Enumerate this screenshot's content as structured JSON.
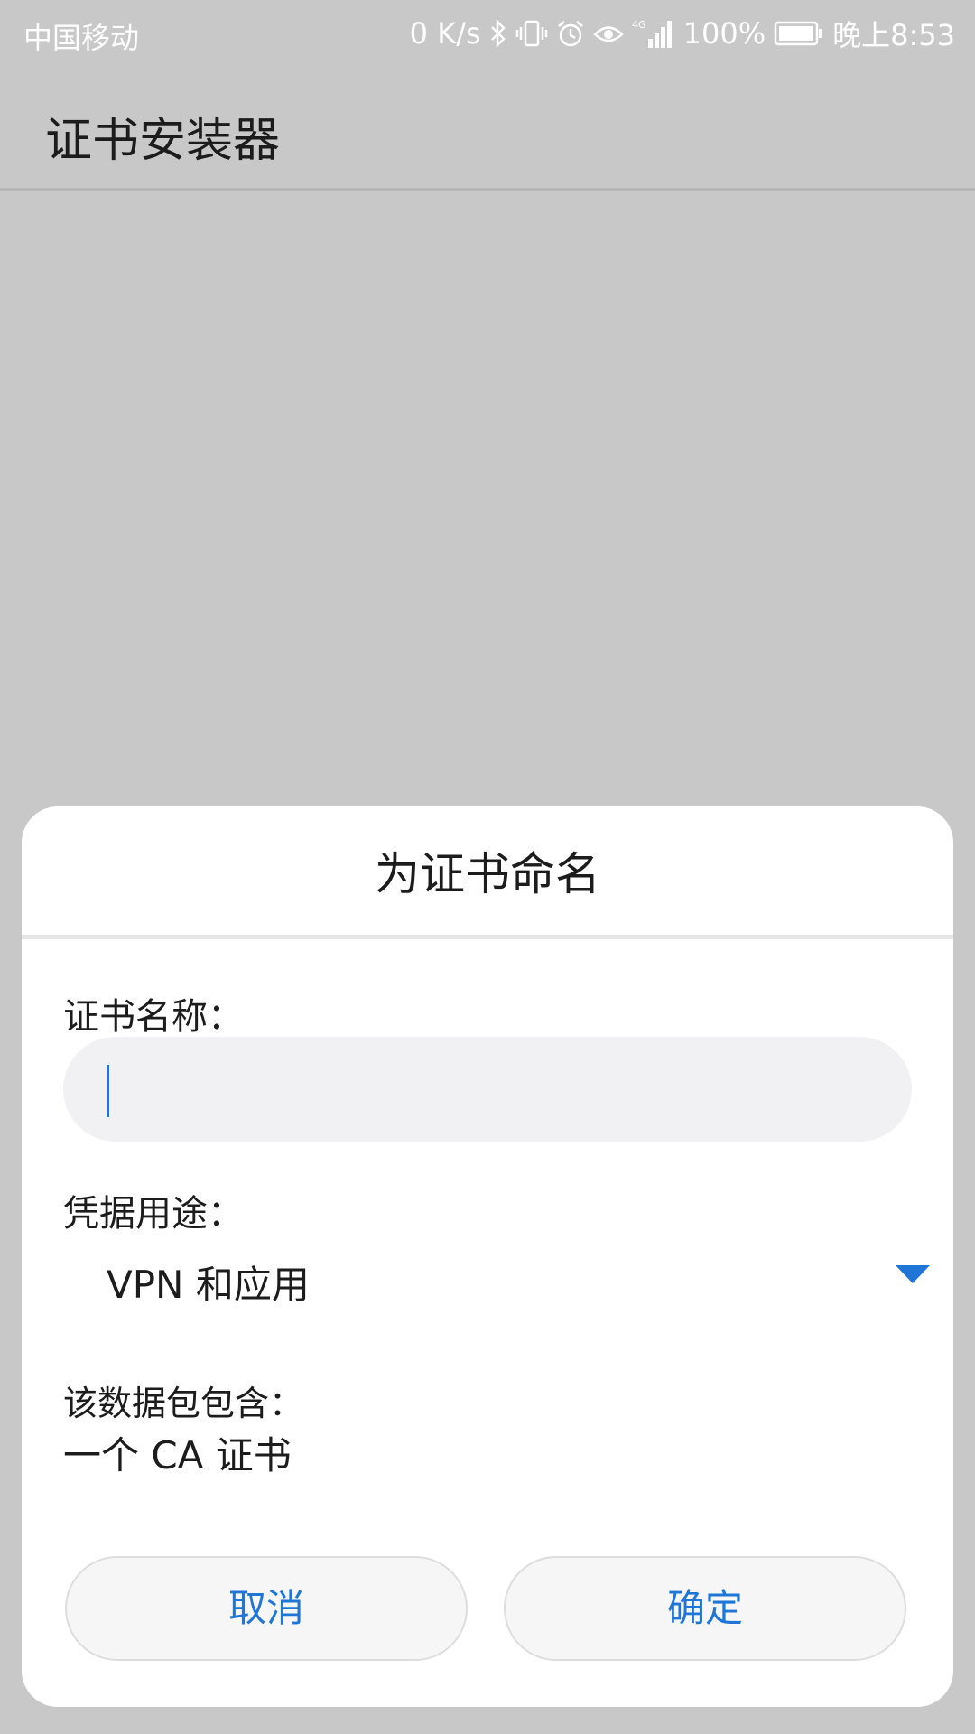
{
  "status_bar": {
    "carrier": "中国移动",
    "speed": "0 K/s",
    "network_type": "4G",
    "battery": "100%",
    "time": "晚上8:53",
    "icons": [
      "bluetooth-icon",
      "vibrate-icon",
      "alarm-icon",
      "eye-comfort-icon",
      "signal-icon",
      "battery-icon"
    ]
  },
  "app_bar": {
    "title": "证书安装器"
  },
  "dialog": {
    "title": "为证书命名",
    "name_label": "证书名称：",
    "name_value": "",
    "usage_label": "凭据用途：",
    "usage_value": "VPN 和应用",
    "contains_label": "该数据包包含：",
    "contains_value": "一个 CA 证书",
    "cancel_label": "取消",
    "ok_label": "确定"
  },
  "colors": {
    "accent": "#1f76d6",
    "scrim": "#c8c8c8",
    "dialog_bg": "#ffffff",
    "input_bg": "#f1f1f3"
  }
}
